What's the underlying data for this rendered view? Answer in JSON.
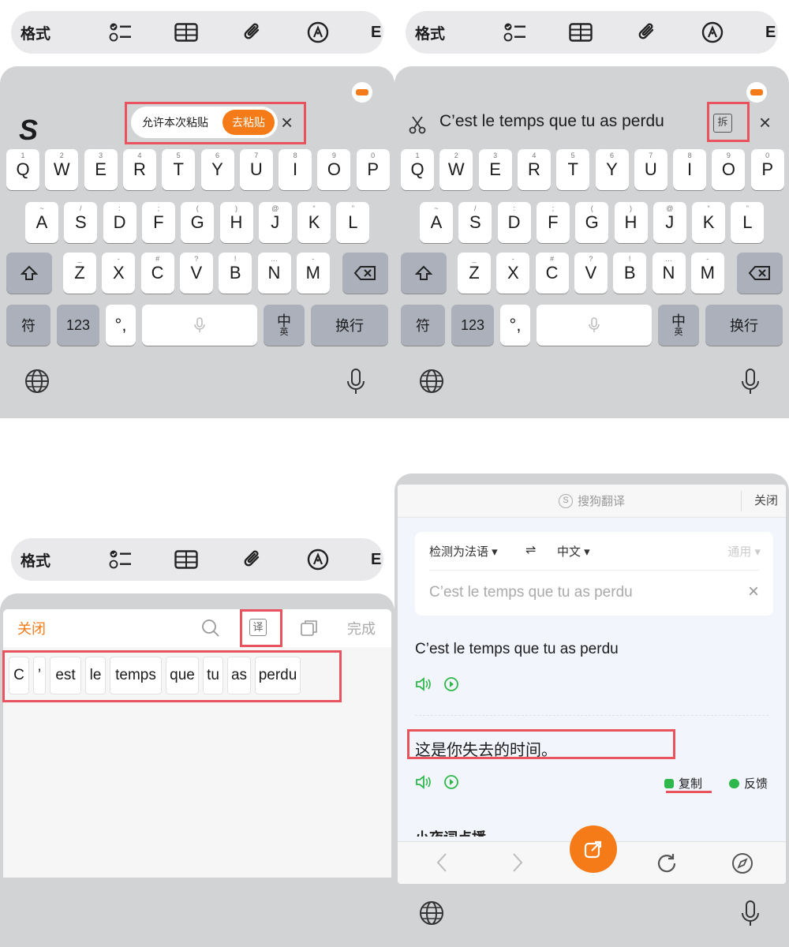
{
  "toolbar": {
    "format_label": "格式",
    "more_label": "E"
  },
  "q1": {
    "brand": "S",
    "paste_prompt": "允许本次粘贴",
    "paste_button": "去粘贴",
    "close": "×"
  },
  "keyboard": {
    "row1": [
      {
        "k": "Q",
        "h": "1"
      },
      {
        "k": "W",
        "h": "2"
      },
      {
        "k": "E",
        "h": "3"
      },
      {
        "k": "R",
        "h": "4"
      },
      {
        "k": "T",
        "h": "5"
      },
      {
        "k": "Y",
        "h": "6"
      },
      {
        "k": "U",
        "h": "7"
      },
      {
        "k": "I",
        "h": "8"
      },
      {
        "k": "O",
        "h": "9"
      },
      {
        "k": "P",
        "h": "0"
      }
    ],
    "row2": [
      {
        "k": "A",
        "h": "~"
      },
      {
        "k": "S",
        "h": "/"
      },
      {
        "k": "D",
        "h": ":"
      },
      {
        "k": "F",
        "h": ";"
      },
      {
        "k": "G",
        "h": "("
      },
      {
        "k": "H",
        "h": ")"
      },
      {
        "k": "J",
        "h": "@"
      },
      {
        "k": "K",
        "h": "“"
      },
      {
        "k": "L",
        "h": "”"
      }
    ],
    "row3": [
      {
        "k": "Z",
        "h": "_"
      },
      {
        "k": "X",
        "h": "-"
      },
      {
        "k": "C",
        "h": "#"
      },
      {
        "k": "V",
        "h": "?"
      },
      {
        "k": "B",
        "h": "!"
      },
      {
        "k": "N",
        "h": "…"
      },
      {
        "k": "M",
        "h": "-"
      }
    ],
    "sym": "符",
    "num": "123",
    "punct": "°,",
    "lang": "中",
    "lang_sub": "英",
    "enter": "换行"
  },
  "q2": {
    "clip_text": "C’est le temps que tu as perdu",
    "split_label": "拆",
    "close": "×"
  },
  "q3": {
    "close": "关闭",
    "translate": "译",
    "done": "完成",
    "tokens": [
      "C",
      "’",
      "est",
      "le",
      "temps",
      "que",
      "tu",
      "as",
      "perdu"
    ]
  },
  "q4": {
    "service": "搜狗翻译",
    "close": "关闭",
    "source_lang": "检测为法语",
    "swap": "⇌",
    "target_lang": "中文",
    "mode": "通用",
    "input_text": "C’est le temps que tu as perdu",
    "clear": "×",
    "source_text": "C’est le temps que tu as perdu",
    "translation": "这是你失去的时间。",
    "copy": "复制",
    "feedback": "反馈",
    "hidden_section": "小夜词点播"
  }
}
